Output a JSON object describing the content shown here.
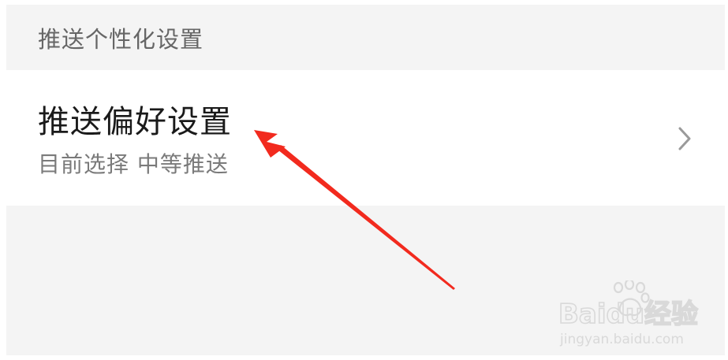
{
  "section": {
    "title": "推送个性化设置"
  },
  "setting": {
    "title": "推送偏好设置",
    "subtitle": "目前选择 中等推送",
    "chevron_icon": "chevron-right-icon"
  },
  "annotation": {
    "arrow_color": "#f22a1e"
  },
  "watermark": {
    "brand": "Baidu经验",
    "site": "jingyan.baidu.com"
  },
  "colors": {
    "background": "#f4f4f4",
    "card": "#ffffff",
    "title": "#1a1a1a",
    "subtitle": "#7a7a7a",
    "section_title": "#666666",
    "chevron": "#9a9a9a"
  }
}
